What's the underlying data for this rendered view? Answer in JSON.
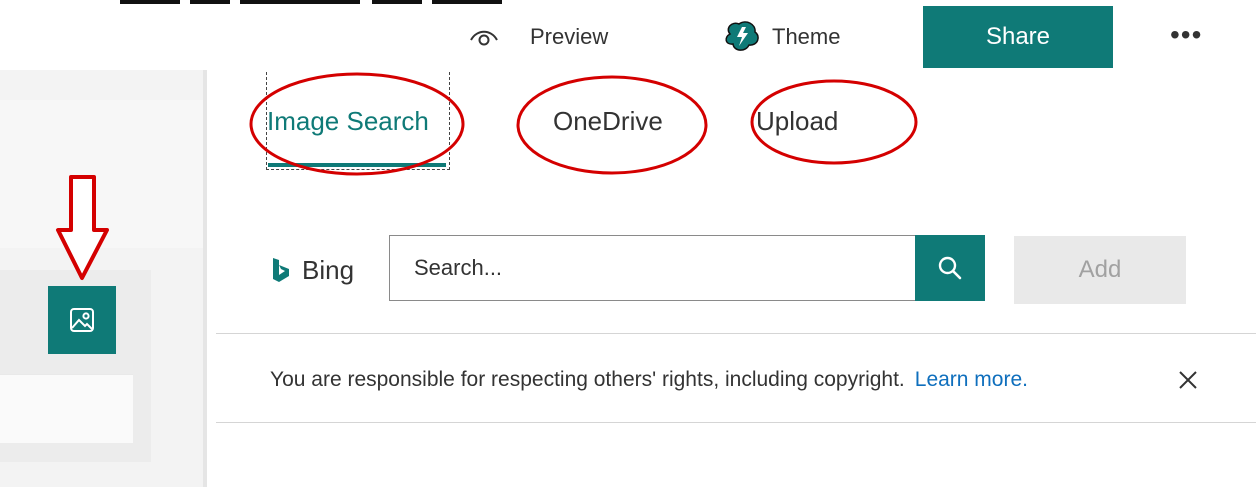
{
  "header": {
    "preview_label": "Preview",
    "preview_icon": "eye-icon",
    "theme_label": "Theme",
    "theme_icon": "palette-icon",
    "share_label": "Share",
    "more_label": "•••",
    "accent_color": "#0f7a77"
  },
  "tabs": [
    {
      "label": "Image Search",
      "selected": true
    },
    {
      "label": "OneDrive",
      "selected": false
    },
    {
      "label": "Upload",
      "selected": false
    }
  ],
  "search": {
    "provider_label": "Bing",
    "provider_icon": "bing-logo-icon",
    "placeholder": "Search...",
    "value": "",
    "search_icon": "search-icon",
    "add_label": "Add"
  },
  "notice": {
    "text": "You are responsible for respecting others' rights, including copyright.",
    "link_label": "Learn more.",
    "close_icon": "close-icon"
  },
  "left_panel": {
    "image_button_icon": "image-icon"
  },
  "annotations": {
    "ellipse_color": "#d40000",
    "arrow_icon": "arrow-down-outline-icon"
  }
}
